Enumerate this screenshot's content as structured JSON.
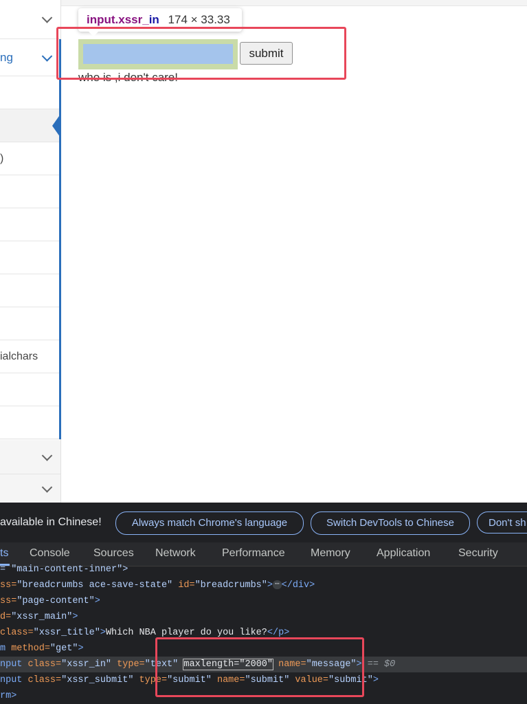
{
  "sidebar": {
    "rows": [
      {
        "label": ""
      },
      {
        "label": "ng"
      },
      {
        "label": ""
      },
      {
        "label": ""
      },
      {
        "label": ")"
      },
      {
        "label": ""
      },
      {
        "label": ""
      },
      {
        "label": ""
      },
      {
        "label": ""
      },
      {
        "label": "ialchars"
      },
      {
        "label": ""
      },
      {
        "label": ""
      },
      {
        "label": ""
      },
      {
        "label": ""
      }
    ]
  },
  "inspector_tooltip": {
    "selector_tag": "input.xssr_",
    "selector_rest": "in",
    "dimensions": "174 × 33.33"
  },
  "form": {
    "input_value": "",
    "submit_label": "submit",
    "result_text": "who is ,i don't care!"
  },
  "devtools": {
    "infobar": {
      "message": "available in Chinese!",
      "buttons": [
        "Always match Chrome's language",
        "Switch DevTools to Chinese",
        "Don't sh"
      ]
    },
    "tabs": [
      "ts",
      "Console",
      "Sources",
      "Network",
      "Performance",
      "Memory",
      "Application",
      "Security"
    ],
    "active_tab": "ts",
    "code": {
      "l1_tail": "= \"main-content-inner\">",
      "l2_cls": "ss=",
      "l2_v1": "\"breadcrumbs ace-save-state\"",
      "l2_id": " id=",
      "l2_v2": "\"breadcrumbs\"",
      "l2_ellipsis": "⋯",
      "l2_end": "</div>",
      "l3_cls": "ss=",
      "l3_v": "\"page-content\"",
      "l4_id": "d=",
      "l4_v": "\"xssr_main\"",
      "l5_cls": "class=",
      "l5_v": "\"xssr_title\"",
      "l5_text": "Which NBA player do you like?",
      "l5_close": "</p>",
      "l6_tag": "m",
      "l6_attr": " method=",
      "l6_v": "\"get\"",
      "l7_tag": "nput",
      "l7_a1": " class=",
      "l7_v1": "\"xssr_in\"",
      "l7_a2": " type=",
      "l7_v2": "\"text\"",
      "l7_a3": "maxlength=",
      "l7_v3": "\"2000\"",
      "l7_a4": " name=",
      "l7_v4": "\"message\"",
      "l7_eq": " == ",
      "l7_dollar": "$0",
      "l8_tag": "nput",
      "l8_a1": " class=",
      "l8_v1": "\"xssr_submit\"",
      "l8_a2": " type=",
      "l8_v2": "\"submit\"",
      "l8_a3": " name=",
      "l8_v3": "\"submit\"",
      "l8_a4": " value=",
      "l8_v4": "\"submit\"",
      "l9_tag": "rm"
    }
  },
  "colors": {
    "annotation_red": "#e8475a",
    "sidebar_blue": "#2a6ebb",
    "input_highlight_padding": "#c9dba8",
    "input_highlight_content": "#a4c4ec"
  }
}
